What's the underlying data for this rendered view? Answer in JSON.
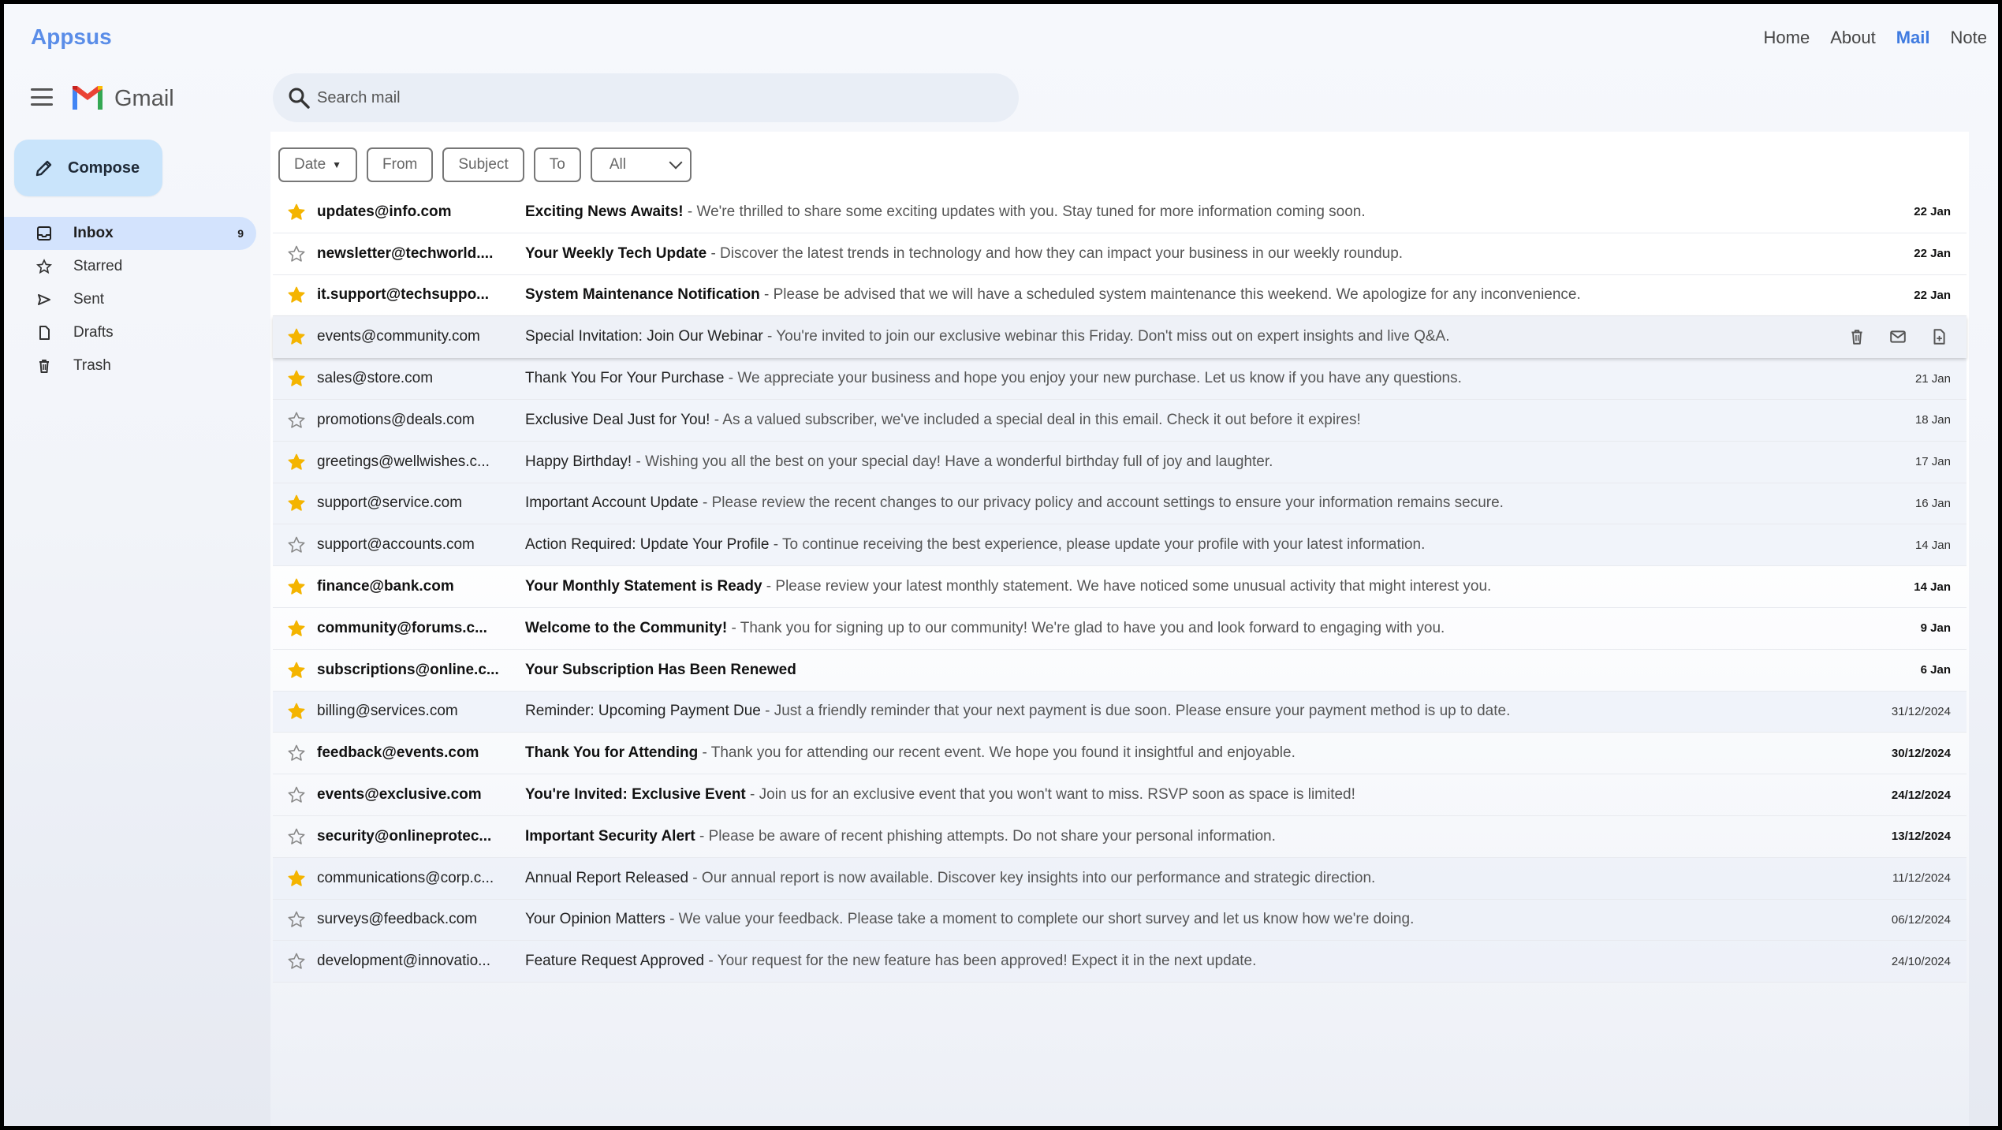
{
  "app": {
    "title": "Appsus"
  },
  "nav": {
    "home": "Home",
    "about": "About",
    "mail": "Mail",
    "note": "Note"
  },
  "header": {
    "brand": "Gmail",
    "search_placeholder": "Search mail"
  },
  "compose": {
    "label": "Compose"
  },
  "sidebar": {
    "items": [
      {
        "label": "Inbox",
        "count": "9",
        "icon": "inbox-icon",
        "active": true
      },
      {
        "label": "Starred",
        "count": "",
        "icon": "star-icon",
        "active": false
      },
      {
        "label": "Sent",
        "count": "",
        "icon": "send-icon",
        "active": false
      },
      {
        "label": "Drafts",
        "count": "",
        "icon": "draft-icon",
        "active": false
      },
      {
        "label": "Trash",
        "count": "",
        "icon": "trash-icon",
        "active": false
      }
    ]
  },
  "filters": {
    "date": "Date",
    "from": "From",
    "subject": "Subject",
    "to": "To",
    "select_value": "All"
  },
  "colors": {
    "accent": "#3f7be0",
    "star": "#f4b400",
    "compose_bg": "#c9e4fb",
    "active_nav_bg": "#d3e3fd"
  },
  "emails": [
    {
      "from": "updates@info.com",
      "subject": "Exciting News Awaits!",
      "snippet": " - We're thrilled to share some exciting updates with you. Stay tuned for more information coming soon.",
      "date": "22 Jan",
      "starred": true,
      "unread": true
    },
    {
      "from": "newsletter@techworld....",
      "subject": "Your Weekly Tech Update",
      "snippet": " - Discover the latest trends in technology and how they can impact your business in our weekly roundup.",
      "date": "22 Jan",
      "starred": false,
      "unread": true
    },
    {
      "from": "it.support@techsuppo...",
      "subject": "System Maintenance Notification",
      "snippet": " - Please be advised that we will have a scheduled system maintenance this weekend. We apologize for any inconvenience.",
      "date": "22 Jan",
      "starred": true,
      "unread": true
    },
    {
      "from": "events@community.com",
      "subject": "Special Invitation: Join Our Webinar",
      "snippet": " - You're invited to join our exclusive webinar this Friday. Don't miss out on expert insights and live Q&A.",
      "date": "",
      "starred": true,
      "unread": false,
      "hover": true
    },
    {
      "from": "sales@store.com",
      "subject": "Thank You For Your Purchase",
      "snippet": " - We appreciate your business and hope you enjoy your new purchase. Let us know if you have any questions.",
      "date": "21 Jan",
      "starred": true,
      "unread": false
    },
    {
      "from": "promotions@deals.com",
      "subject": "Exclusive Deal Just for You!",
      "snippet": " - As a valued subscriber, we've included a special deal in this email. Check it out before it expires!",
      "date": "18 Jan",
      "starred": false,
      "unread": false
    },
    {
      "from": "greetings@wellwishes.c...",
      "subject": "Happy Birthday!",
      "snippet": " - Wishing you all the best on your special day! Have a wonderful birthday full of joy and laughter.",
      "date": "17 Jan",
      "starred": true,
      "unread": false
    },
    {
      "from": "support@service.com",
      "subject": "Important Account Update",
      "snippet": " - Please review the recent changes to our privacy policy and account settings to ensure your information remains secure.",
      "date": "16 Jan",
      "starred": true,
      "unread": false
    },
    {
      "from": "support@accounts.com",
      "subject": "Action Required: Update Your Profile",
      "snippet": " - To continue receiving the best experience, please update your profile with your latest information.",
      "date": "14 Jan",
      "starred": false,
      "unread": false
    },
    {
      "from": "finance@bank.com",
      "subject": "Your Monthly Statement is Ready",
      "snippet": " - Please review your latest monthly statement. We have noticed some unusual activity that might interest you.",
      "date": "14 Jan",
      "starred": true,
      "unread": true
    },
    {
      "from": "community@forums.c...",
      "subject": "Welcome to the Community!",
      "snippet": " - Thank you for signing up to our community! We're glad to have you and look forward to engaging with you.",
      "date": "9 Jan",
      "starred": true,
      "unread": true
    },
    {
      "from": "subscriptions@online.c...",
      "subject": "Your Subscription Has Been Renewed",
      "snippet": "",
      "date": "6 Jan",
      "starred": true,
      "unread": true
    },
    {
      "from": "billing@services.com",
      "subject": "Reminder: Upcoming Payment Due",
      "snippet": " - Just a friendly reminder that your next payment is due soon. Please ensure your payment method is up to date.",
      "date": "31/12/2024",
      "starred": true,
      "unread": false
    },
    {
      "from": "feedback@events.com",
      "subject": "Thank You for Attending",
      "snippet": " - Thank you for attending our recent event. We hope you found it insightful and enjoyable.",
      "date": "30/12/2024",
      "starred": false,
      "unread": true
    },
    {
      "from": "events@exclusive.com",
      "subject": "You're Invited: Exclusive Event",
      "snippet": " - Join us for an exclusive event that you won't want to miss. RSVP soon as space is limited!",
      "date": "24/12/2024",
      "starred": false,
      "unread": true
    },
    {
      "from": "security@onlineprotec...",
      "subject": "Important Security Alert",
      "snippet": " - Please be aware of recent phishing attempts. Do not share your personal information.",
      "date": "13/12/2024",
      "starred": false,
      "unread": true
    },
    {
      "from": "communications@corp.c...",
      "subject": "Annual Report Released",
      "snippet": " - Our annual report is now available. Discover key insights into our performance and strategic direction.",
      "date": "11/12/2024",
      "starred": true,
      "unread": false
    },
    {
      "from": "surveys@feedback.com",
      "subject": "Your Opinion Matters",
      "snippet": " - We value your feedback. Please take a moment to complete our short survey and let us know how we're doing.",
      "date": "06/12/2024",
      "starred": false,
      "unread": false
    },
    {
      "from": "development@innovatio...",
      "subject": "Feature Request Approved",
      "snippet": " - Your request for the new feature has been approved! Expect it in the next update.",
      "date": "24/10/2024",
      "starred": false,
      "unread": false
    }
  ]
}
